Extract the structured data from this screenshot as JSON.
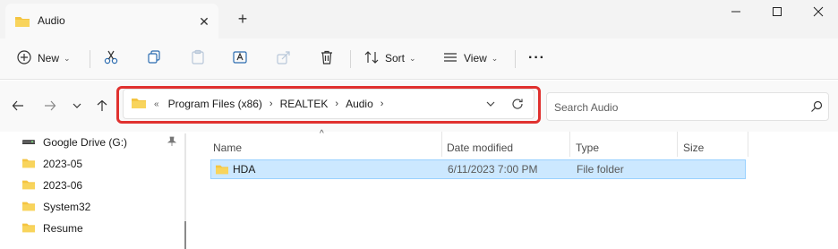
{
  "window": {
    "tab_title": "Audio",
    "new_tab": "+"
  },
  "toolbar": {
    "new_label": "New",
    "sort_label": "Sort",
    "view_label": "View",
    "more": "···"
  },
  "address": {
    "overflow": "«",
    "crumbs": [
      "Program Files (x86)",
      "REALTEK",
      "Audio"
    ]
  },
  "search": {
    "placeholder": "Search Audio"
  },
  "sidebar": {
    "items": [
      {
        "label": "Google Drive (G:)",
        "icon": "drive-icon"
      },
      {
        "label": "2023-05",
        "icon": "folder-icon"
      },
      {
        "label": "2023-06",
        "icon": "folder-icon"
      },
      {
        "label": "System32",
        "icon": "folder-icon"
      },
      {
        "label": "Resume",
        "icon": "folder-icon"
      }
    ]
  },
  "filelist": {
    "columns": [
      "Name",
      "Date modified",
      "Type",
      "Size"
    ],
    "rows": [
      {
        "name": "HDA",
        "date": "6/11/2023 7:00 PM",
        "type": "File folder",
        "size": ""
      }
    ]
  },
  "colors": {
    "folder": "#f4c441",
    "selection": "#cce8ff",
    "highlight": "#e0312f"
  }
}
